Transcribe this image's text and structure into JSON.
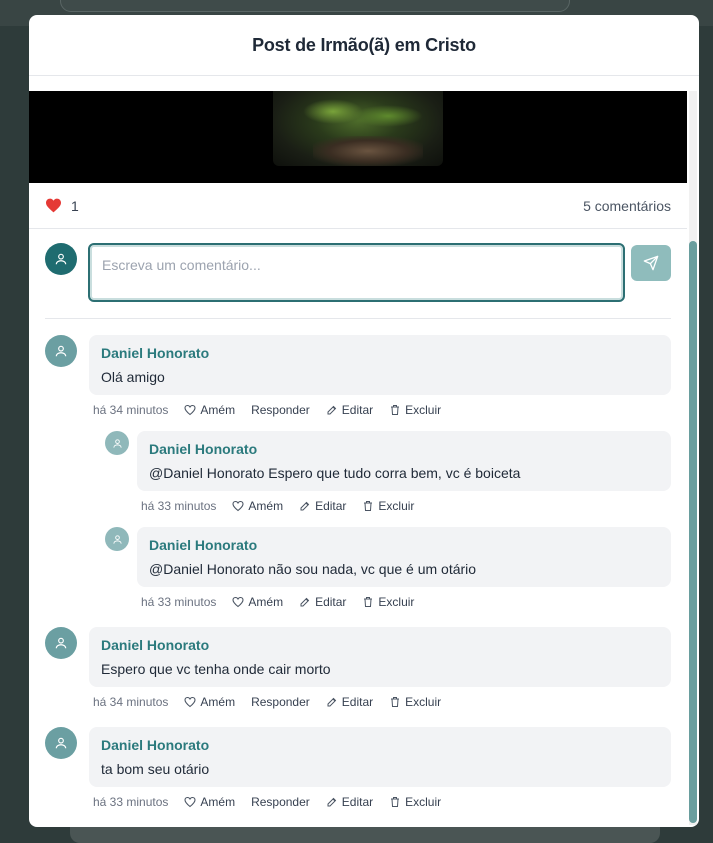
{
  "modal": {
    "title": "Post de Irmão(ã) em Cristo"
  },
  "post": {
    "likes": "1",
    "comments_count": "5 comentários"
  },
  "composer": {
    "placeholder": "Escreva um comentário..."
  },
  "comments": [
    {
      "author": "Daniel Honorato",
      "text": "Olá amigo",
      "time": "há 34 minutos",
      "amen": "Amém",
      "reply": "Responder",
      "edit": "Editar",
      "delete": "Excluir"
    },
    {
      "author": "Daniel Honorato",
      "text": "@Daniel Honorato Espero que tudo corra bem, vc é boiceta",
      "time": "há 33 minutos",
      "amen": "Amém",
      "edit": "Editar",
      "delete": "Excluir"
    },
    {
      "author": "Daniel Honorato",
      "text": "@Daniel Honorato não sou nada, vc que é um otário",
      "time": "há 33 minutos",
      "amen": "Amém",
      "edit": "Editar",
      "delete": "Excluir"
    },
    {
      "author": "Daniel Honorato",
      "text": "Espero que vc tenha onde cair morto",
      "time": "há 34 minutos",
      "amen": "Amém",
      "reply": "Responder",
      "edit": "Editar",
      "delete": "Excluir"
    },
    {
      "author": "Daniel Honorato",
      "text": "ta bom seu otário",
      "time": "há 33 minutos",
      "amen": "Amém",
      "reply": "Responder",
      "edit": "Editar",
      "delete": "Excluir"
    }
  ],
  "colors": {
    "accent": "#2b7a7d",
    "like": "#e53935",
    "send_button": "#8fbcbc"
  }
}
